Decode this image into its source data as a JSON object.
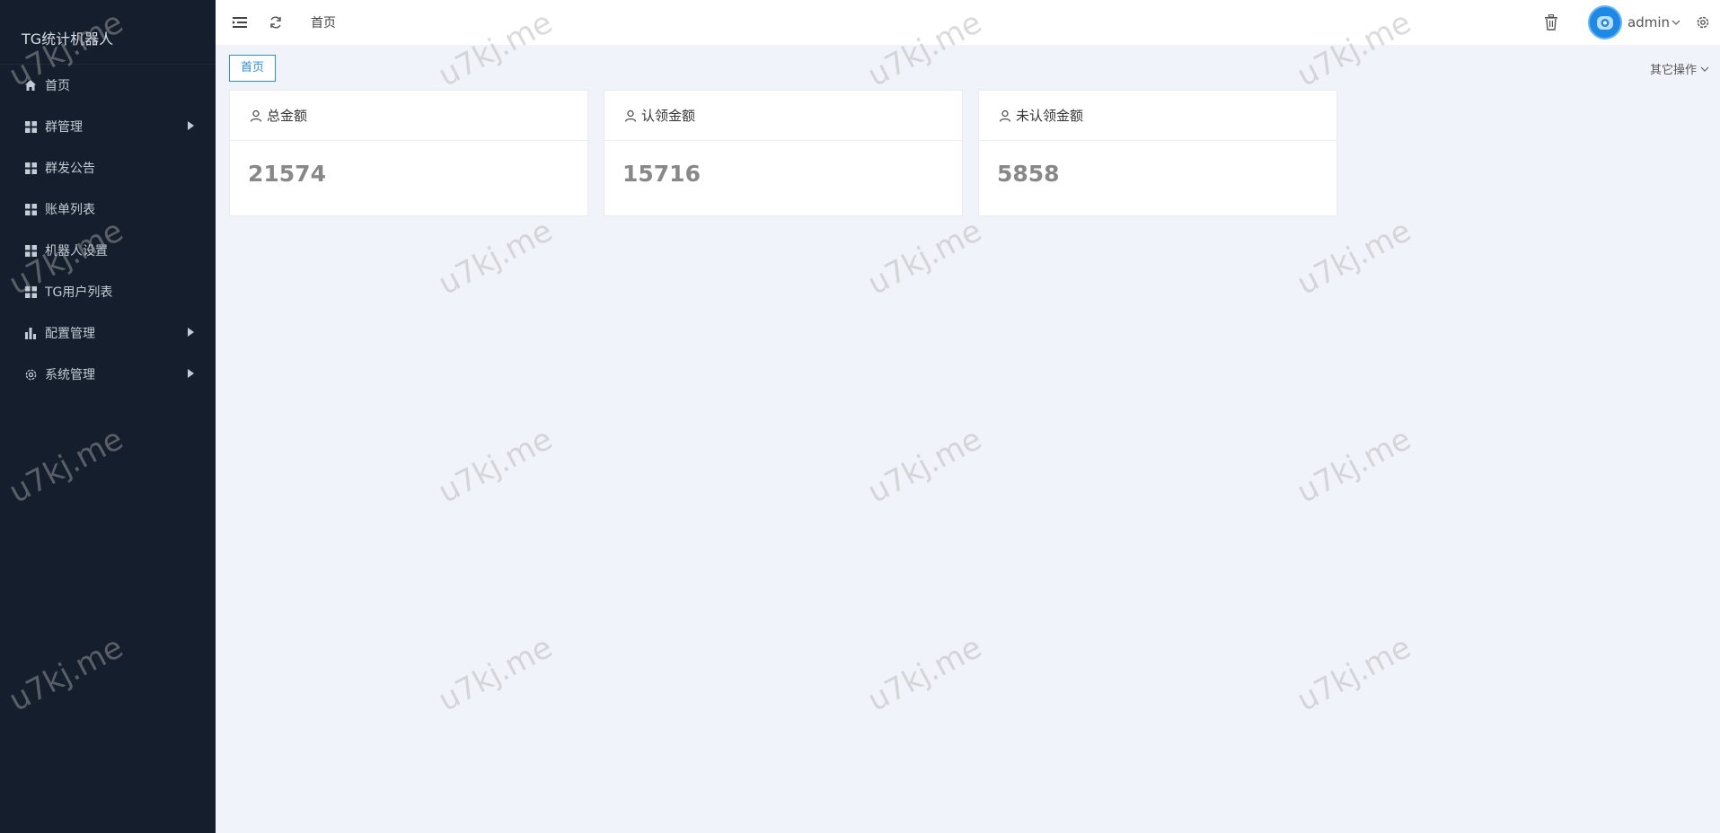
{
  "app": {
    "title": "TG统计机器人"
  },
  "sidebar": {
    "items": [
      {
        "label": "首页",
        "icon": "home-icon",
        "submenu": false
      },
      {
        "label": "群管理",
        "icon": "grid-icon",
        "submenu": true
      },
      {
        "label": "群发公告",
        "icon": "grid-icon",
        "submenu": false
      },
      {
        "label": "账单列表",
        "icon": "grid-icon",
        "submenu": false
      },
      {
        "label": "机器人设置",
        "icon": "grid-icon",
        "submenu": false
      },
      {
        "label": "TG用户列表",
        "icon": "grid-icon",
        "submenu": false
      },
      {
        "label": "配置管理",
        "icon": "bar-chart-icon",
        "submenu": true
      },
      {
        "label": "系统管理",
        "icon": "gear-icon",
        "submenu": true
      }
    ]
  },
  "header": {
    "breadcrumb": "首页",
    "username": "admin"
  },
  "tagbar": {
    "active_tag": "首页",
    "other_ops": "其它操作"
  },
  "cards": [
    {
      "title": "总金额",
      "value": "21574"
    },
    {
      "title": "认领金额",
      "value": "15716"
    },
    {
      "title": "未认领金额",
      "value": "5858"
    }
  ],
  "watermark": "u7kj.me",
  "colors": {
    "sidebar_bg": "#141e2c",
    "accent": "#2d8cf0",
    "page_bg": "#f0f4fa"
  }
}
